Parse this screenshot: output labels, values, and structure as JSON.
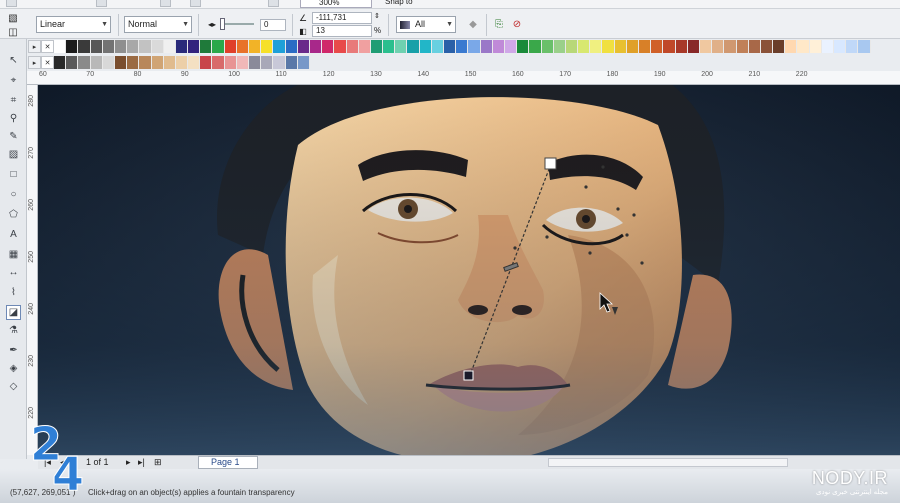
{
  "top_strip": {
    "zoom_value": "300%",
    "snap_label": "Snap to"
  },
  "property_bar": {
    "transparency_type": "Linear",
    "merge_mode": "Normal",
    "start_transparency": "0",
    "angle": "-111,731",
    "edge_pad": "13",
    "edge_pad_unit": "%",
    "apply_to": "All"
  },
  "rulers": {
    "horizontal": [
      "60",
      "70",
      "80",
      "90",
      "100",
      "110",
      "120",
      "130",
      "140",
      "150",
      "160",
      "170",
      "180",
      "190",
      "200",
      "210",
      "220"
    ],
    "vertical": [
      "280",
      "270",
      "260",
      "250",
      "240",
      "230",
      "220"
    ]
  },
  "page_nav": {
    "counter": "1 of 1",
    "tab": "Page 1"
  },
  "status": {
    "coords": "(57,627, 269,051 )",
    "hint": "Click+drag on an object(s) applies a fountain transparency"
  },
  "palette_row1": [
    "#ffffff",
    "#1b1b1b",
    "#3a3a3a",
    "#575757",
    "#737373",
    "#8f8f8f",
    "#a8a8a8",
    "#c2c2c2",
    "#dadada",
    "#f0f0f0",
    "#2a2a7a",
    "#33227d",
    "#1f7a3a",
    "#2aa84a",
    "#e0402a",
    "#e8722a",
    "#f2b327",
    "#f6e028",
    "#1ea0d8",
    "#2b6cc4",
    "#6a2a8a",
    "#a8288a",
    "#d0286a",
    "#e84a4a",
    "#e87a7a",
    "#f0a0a0",
    "#1f9d74",
    "#2bbf8e",
    "#6fd1b0",
    "#18a0a8",
    "#22b6c8",
    "#68d0e0",
    "#2a60a8",
    "#3a7ad0",
    "#7aa8e8",
    "#9a78c8",
    "#c08ad8",
    "#d0a8e8",
    "#1a8a3a",
    "#3aa84a",
    "#6ac06a",
    "#9ad08a",
    "#b8d878",
    "#d8e870",
    "#f0f080",
    "#f0e040",
    "#e8c030",
    "#e0a028",
    "#d88028",
    "#d06028",
    "#c04828",
    "#a83828",
    "#882828",
    "#f0c8a0",
    "#e0b088",
    "#d09870",
    "#c08058",
    "#a86848",
    "#8a5238",
    "#6a3e2a",
    "#ffd8b0",
    "#ffe8c8",
    "#fff0d8",
    "#eaf2ff",
    "#d8e8ff",
    "#c0d8f8",
    "#a8c8f0"
  ],
  "palette_row2": [
    "#2a2a2a",
    "#5a5a5a",
    "#8a8a8a",
    "#b8b8b8",
    "#d8d8d8",
    "#7a4e2e",
    "#9a6a42",
    "#b8875a",
    "#d0a474",
    "#e0bb8e",
    "#eccfa8",
    "#f4e0c2",
    "#c8444a",
    "#d86a6a",
    "#e89494",
    "#f0b8b8",
    "#8a8a9a",
    "#a8a8b8",
    "#c8c8d8",
    "#5a78a8",
    "#7898c8"
  ],
  "colors": {
    "canvas_bg": "#142233",
    "accent": "#2a4b8a",
    "watermark_blue": "#2f7fd6"
  },
  "watermark": {
    "brand": "NODY.IR",
    "tagline": "مجله اینترنتی خبری نودی",
    "logo_text": "24"
  },
  "icons": [
    "pointer-tool-icon",
    "shape-tool-icon",
    "crop-tool-icon",
    "zoom-tool-icon",
    "freehand-tool-icon",
    "smart-fill-icon",
    "rectangle-tool-icon",
    "ellipse-tool-icon",
    "polygon-tool-icon",
    "text-tool-icon",
    "table-tool-icon",
    "dimension-tool-icon",
    "connector-tool-icon",
    "transparency-tool-icon",
    "eyedropper-icon",
    "outline-pen-icon",
    "fill-tool-icon",
    "interactive-fill-icon"
  ]
}
